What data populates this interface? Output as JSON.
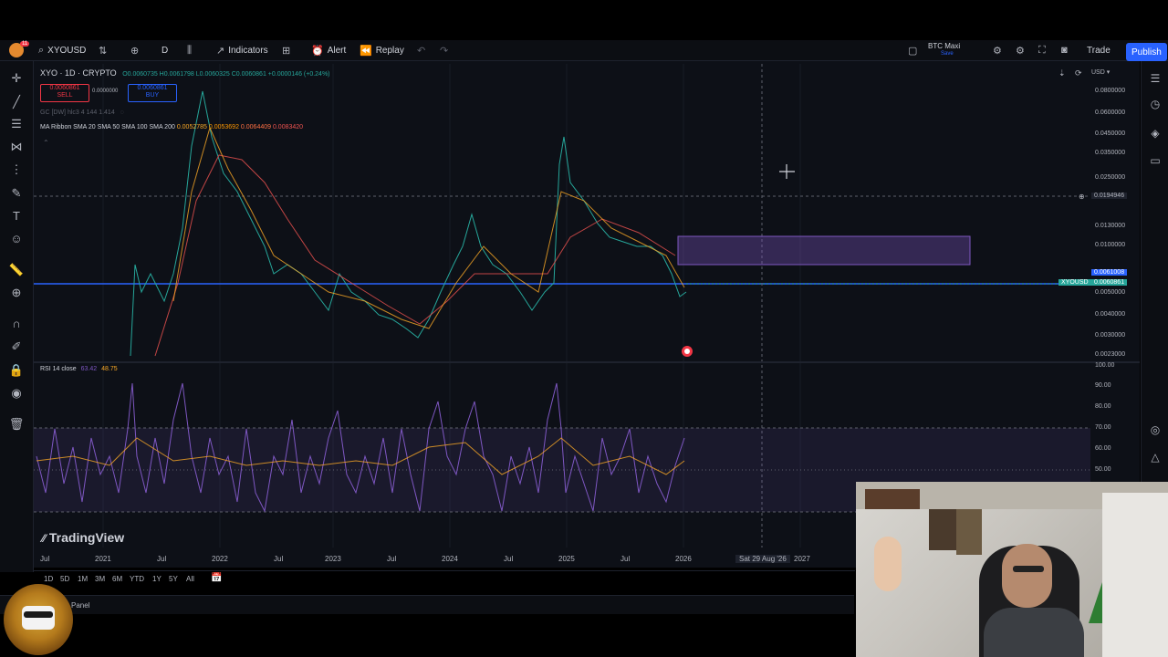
{
  "toolbar": {
    "symbol": "XYOUSD",
    "interval": "D",
    "indicators_label": "Indicators",
    "alert_label": "Alert",
    "replay_label": "Replay",
    "watchlist_name": "BTC Maxi",
    "watchlist_sub": "Save",
    "trade_label": "Trade",
    "publish_label": "Publish",
    "notif_badge": "11"
  },
  "legend": {
    "title": "XYO · 1D · CRYPTO",
    "ohlc": "O0.0060735 H0.0061798 L0.0060325 C0.0060861 +0.0000146 (+0.24%)",
    "sell_price": "0.0060861",
    "sell_label": "SELL",
    "spread": "0.0000000",
    "buy_price": "0.0060861",
    "buy_label": "BUY",
    "gc_line": "GC [DW] hlc3 4 144 1.414",
    "ma_title": "MA Ribbon SMA 20 SMA 50 SMA 100 SMA 200",
    "ma_vals": [
      "0.0052785",
      "0.0053692",
      "0.0064409",
      "0.0083420"
    ],
    "rsi_title": "RSI 14 close",
    "rsi_val1": "63.42",
    "rsi_val2": "48.75"
  },
  "price_axis": {
    "currency": "USD",
    "labels": [
      "0.0800000",
      "0.0600000",
      "0.0450000",
      "0.0350000",
      "0.0250000",
      "0.0194946",
      "0.0130000",
      "0.0100000",
      "0.0061008",
      "0.0060861",
      "0.0050000",
      "0.0040000",
      "0.0030000",
      "0.0023000"
    ],
    "symbol_tag": "XYOUSD"
  },
  "rsi_axis": {
    "labels": [
      "100.00",
      "90.00",
      "80.00",
      "70.00",
      "60.00",
      "50.00"
    ]
  },
  "time_axis": {
    "labels": [
      "Jul",
      "2021",
      "Jul",
      "2022",
      "Jul",
      "2023",
      "Jul",
      "2024",
      "Jul",
      "2025",
      "Jul",
      "2026",
      "Sat 29 Aug '26",
      "2027"
    ]
  },
  "ranges": [
    "1D",
    "5D",
    "1M",
    "3M",
    "6M",
    "YTD",
    "1Y",
    "5Y",
    "All"
  ],
  "watermark": "TradingView",
  "panel_label": "Panel",
  "colors": {
    "bg": "#0d1017",
    "up": "#26a69a",
    "down": "#ef5350",
    "accent": "#2962ff",
    "box": "#7e57c2",
    "rsi": "#7e57c2",
    "rsi_ma": "#f9a825"
  },
  "icons": [
    "search-icon",
    "plus-icon",
    "compare-icon",
    "indicators-icon",
    "alert-icon",
    "replay-icon",
    "undo-icon",
    "redo-icon",
    "camera-icon",
    "fullscreen-icon",
    "settings-icon",
    "crosshair-icon",
    "trend-line-icon",
    "fib-icon",
    "text-icon",
    "emoji-icon",
    "ruler-icon",
    "zoom-icon",
    "magnet-icon",
    "lock-icon",
    "eye-icon",
    "trash-icon",
    "watchlist-icon",
    "alerts-icon",
    "layers-icon",
    "chat-icon"
  ]
}
